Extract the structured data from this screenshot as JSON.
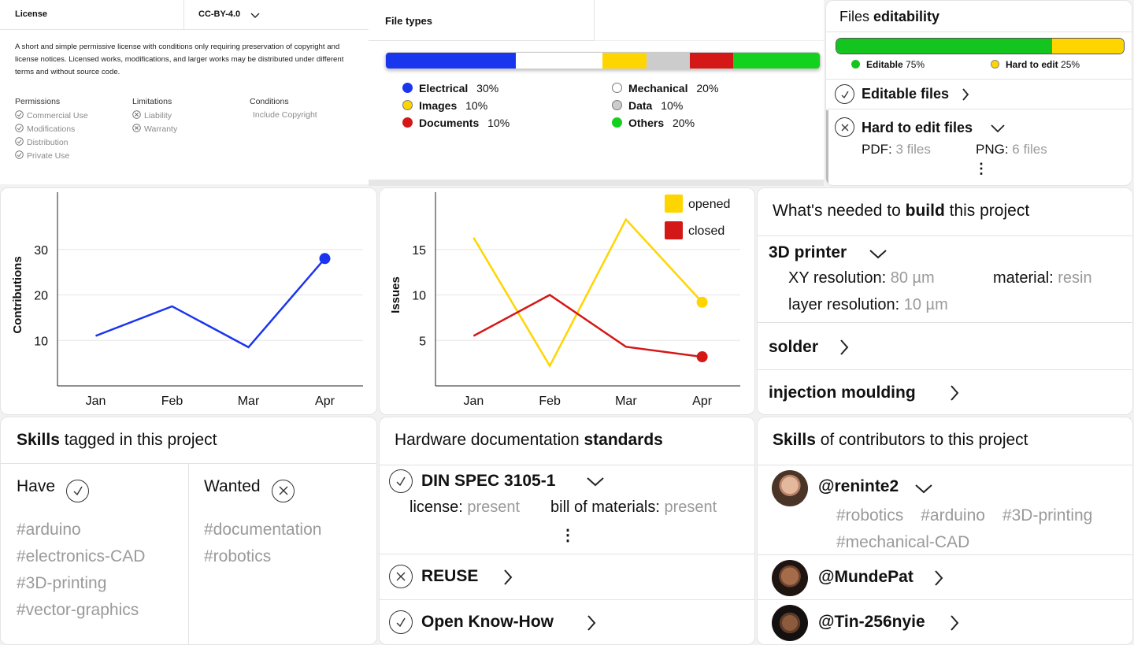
{
  "license": {
    "label": "License",
    "value": "CC-BY-4.0",
    "description": "A short and simple permissive license with conditions only requiring preservation of copyright and license notices. Licensed works, modifications, and larger works may be distributed under different terms and without source code.",
    "permissions_title": "Permissions",
    "permissions": [
      "Commercial Use",
      "Modifications",
      "Distribution",
      "Private Use"
    ],
    "limitations_title": "Limitations",
    "limitations": [
      "Liability",
      "Warranty"
    ],
    "conditions_title": "Conditions",
    "conditions": [
      "Include Copyright"
    ]
  },
  "file_types": {
    "title": "File types",
    "segments": [
      {
        "name": "Electrical",
        "pct": "30%",
        "value": 30,
        "color": "#1a35ee"
      },
      {
        "name": "Mechanical",
        "pct": "20%",
        "value": 20,
        "color": "#ffffff"
      },
      {
        "name": "Images",
        "pct": "10%",
        "value": 10,
        "color": "#ffd500"
      },
      {
        "name": "Data",
        "pct": "10%",
        "value": 10,
        "color": "#cccccc"
      },
      {
        "name": "Documents",
        "pct": "10%",
        "value": 10,
        "color": "#d41717"
      },
      {
        "name": "Others",
        "pct": "20%",
        "value": 20,
        "color": "#14d11f"
      }
    ]
  },
  "editability": {
    "title_plain": "Files ",
    "title_bold": "editability",
    "editable_label": "Editable",
    "editable_pct": "75%",
    "editable_value": 75,
    "hard_label": "Hard to edit",
    "hard_pct": "25%",
    "hard_value": 25,
    "editable_files": "Editable files",
    "hard_files": "Hard to edit files",
    "pdf_label": "PDF:",
    "pdf_value": "3 files",
    "png_label": "PNG:",
    "png_value": "6 files",
    "more": "⋮"
  },
  "chart_data": [
    {
      "type": "line",
      "x": [
        "Jan",
        "Feb",
        "Mar",
        "Apr"
      ],
      "ylabel": "Contributions",
      "yticks": [
        10,
        20,
        30
      ],
      "ylim": [
        0,
        40
      ],
      "series": [
        {
          "values": [
            11,
            17.5,
            8.5,
            28
          ],
          "color": "#1a35ee"
        }
      ]
    },
    {
      "type": "line",
      "x": [
        "Jan",
        "Feb",
        "Mar",
        "Apr"
      ],
      "ylabel": "Issues",
      "yticks": [
        5,
        10,
        15
      ],
      "ylim": [
        0,
        20
      ],
      "legend": "top-right",
      "series": [
        {
          "name": "opened",
          "values": [
            16.3,
            2.2,
            18.3,
            9.2
          ],
          "color": "#ffd500"
        },
        {
          "name": "closed",
          "values": [
            5.5,
            10,
            4.3,
            3.2
          ],
          "color": "#d41717"
        }
      ]
    }
  ],
  "build": {
    "title_plain1": "What's needed to ",
    "title_bold": "build",
    "title_plain2": " this project",
    "printer": "3D printer",
    "xy_label": "XY resolution:",
    "xy_value": "80 µm",
    "material_label": "material:",
    "material_value": "resin",
    "layer_label": "layer resolution:",
    "layer_value": "10 µm",
    "solder": "solder",
    "injection": "injection moulding"
  },
  "skills": {
    "title_bold": "Skills",
    "title_plain": " tagged in this project",
    "have": "Have",
    "wanted": "Wanted",
    "have_tags": [
      "#arduino",
      "#electronics-CAD",
      "#3D-printing",
      "#vector-graphics"
    ],
    "wanted_tags": [
      "#documentation",
      "#robotics"
    ]
  },
  "standards": {
    "title_plain": "Hardware documentation ",
    "title_bold": "standards",
    "din": "DIN SPEC 3105-1",
    "license_label": "license:",
    "license_value": "present",
    "bom_label": "bill of materials:",
    "bom_value": "present",
    "more": "⋮",
    "reuse": "REUSE",
    "okh": "Open Know-How"
  },
  "contributors": {
    "title_bold": "Skills",
    "title_plain": " of contributors to this project",
    "users": [
      {
        "handle": "@reninte2",
        "tags": [
          "#robotics",
          "#arduino",
          "#3D-printing",
          "#mechanical-CAD"
        ]
      },
      {
        "handle": "@MundePat"
      },
      {
        "handle": "@Tin-256nyie"
      }
    ]
  }
}
